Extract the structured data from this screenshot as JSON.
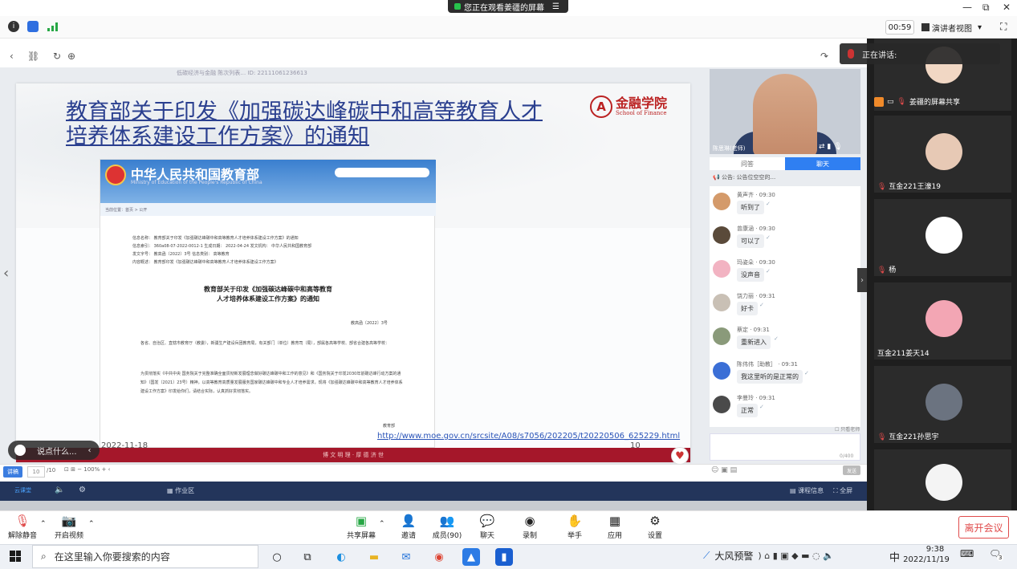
{
  "titlebar": {
    "share_status": "您正在观看姜疆的屏幕",
    "minimize": "—",
    "restore": "⧉",
    "close": "✕"
  },
  "meeting_top": {
    "timer": "00:59",
    "view_mode": "演讲者视图",
    "view_caret": "▾"
  },
  "slide": {
    "meta_text": "低碳经济与金融 陈次列表…    ID: 22111061236613",
    "title": "教育部关于印发《加强碳达峰碳中和高等教育人才培养体系建设工作方案》的通知",
    "school_name": "金融学院",
    "school_en": "School of Finance",
    "doc_header_title": "中华人民共和国教育部",
    "doc_header_en": "Ministry of Education of the People's Republic of China",
    "breadcrumb": "当前位置：首页 > 公开",
    "meta_lines": [
      "信息名称：  教育部关于印发《加强碳达峰碳中和高等教育人才培养体系建设工作方案》的通知",
      "信息索引：  360a08-07-2022-0012-1    生成日期：  2022-04-24        发文机构：  中华人民共和国教育部",
      "发文字号：  教高函〔2022〕3号         信息类别：  高等教育",
      "内容概述：  教育部印发《加强碳达峰碳中和高等教育人才培养体系建设工作方案》"
    ],
    "doc_heading_1": "教育部关于印发《加强碳达峰碳中和高等教育",
    "doc_heading_2": "人才培养体系建设工作方案》的通知",
    "doc_ref": "教高函〔2022〕3号",
    "doc_para_1": "各省、自治区、直辖市教育厅（教委），新疆生产建设兵团教育局，有关部门（单位）教育司（局），部属各高等学校、部省合建各高等学校：",
    "doc_para_2": "为贯彻落实《中共中央 国务院关于完整准确全面贯彻新发展理念做好碳达峰碳中和工作的意见》和《国务院关于印发2030年前碳达峰行动方案的通知》（国发〔2021〕23号）精神，以高等教育高质量发展服务国家碳达峰碳中和专业人才培养需求，现将《加强碳达峰碳中和高等教育人才培养体系建设工作方案》印发给你们，请结合实际，认真抓好贯彻落实。",
    "doc_sign": "教育部",
    "url": "http://www.moe.gov.cn/srcsite/A08/s7056/202205/t20220506_625229.html",
    "date": "2022-11-18",
    "page_num": "10",
    "footer_motto": "博 文 明 理 · 厚 德 济 世",
    "comment_placeholder": "说点什么...",
    "comment_arrow": "‹"
  },
  "slide_controls": {
    "tag": "讲稿",
    "page_current": "10",
    "page_total": "/10",
    "zoom": "− 100% +"
  },
  "platform": {
    "workzone": "作业区",
    "course_info": "课程信息",
    "fullscreen": "全屏",
    "logo": "云课堂"
  },
  "classroom": {
    "teacher_name": "陈思琳(老师)",
    "tab_qa": "问答",
    "tab_chat": "聊天",
    "notice": "公告: 公告位空空的...",
    "only_teacher": "只看老师",
    "char_count": "0/400",
    "send": "发送",
    "messages": [
      {
        "who": "黄声齐  ·  09:30",
        "text": "听到了"
      },
      {
        "who": "曾康涵  ·  09:30",
        "text": "可以了"
      },
      {
        "who": "玛姿朵  ·  09:30",
        "text": "没声音"
      },
      {
        "who": "饶力丽  ·  09:31",
        "text": "好卡"
      },
      {
        "who": "蔡定  ·  09:31",
        "text": "重新进入"
      },
      {
        "who": "陈伟伟［助教］  ·  09:31",
        "text": "我这里听的是正常的"
      },
      {
        "who": "李曼玲  ·  09:31",
        "text": "正常"
      }
    ]
  },
  "gallery": {
    "speaking_label": "正在讲话:",
    "share_label": "姜疆的屏幕共享",
    "tiles": [
      "互金221王濠19",
      "杨",
      "互金211姜天14",
      "互金221孙思宇"
    ]
  },
  "meetingbar": {
    "unmute": "解除静音",
    "video": "开启视频",
    "share": "共享屏幕",
    "invite": "邀请",
    "members": "成员(90)",
    "chat": "聊天",
    "record": "录制",
    "raise": "举手",
    "apps": "应用",
    "settings": "设置",
    "leave": "离开会议"
  },
  "taskbar": {
    "search_placeholder": "在这里输入你要搜索的内容",
    "weather": "大风预警",
    "ime": "中",
    "time": "9:38",
    "date": "2022/11/19",
    "notif_count": "3"
  }
}
